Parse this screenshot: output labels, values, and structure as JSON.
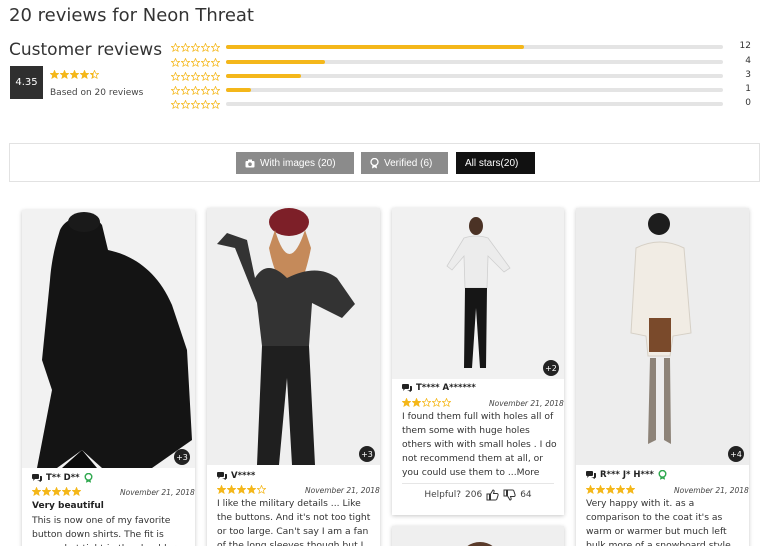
{
  "page": {
    "title": "20 reviews for Neon Threat"
  },
  "summary": {
    "heading": "Customer reviews",
    "average": "4.35",
    "average_stars": 4.35,
    "based_on": "Based on 20 reviews",
    "distribution": [
      {
        "stars": 5,
        "count": "12",
        "fraction": 0.6
      },
      {
        "stars": 4,
        "count": "4",
        "fraction": 0.2
      },
      {
        "stars": 3,
        "count": "3",
        "fraction": 0.15
      },
      {
        "stars": 2,
        "count": "1",
        "fraction": 0.05
      },
      {
        "stars": 1,
        "count": "0",
        "fraction": 0.0
      }
    ]
  },
  "filters": {
    "with_images": "With images (20)",
    "verified": "Verified (6)",
    "all_stars": "All stars(20)"
  },
  "colors": {
    "star": "#f4b71a",
    "bar_track": "#e4e4e4",
    "verified_badge": "#2fa84f"
  },
  "reviews": [
    {
      "author": "T** D**",
      "verified": true,
      "date": "November 21, 2018",
      "stars": 5,
      "extra_images": "+3",
      "title": "Very beautiful",
      "body": "This is now one of my favorite button down shirts. The fit is somewhat tight in the shoulders"
    },
    {
      "author": "V****",
      "verified": false,
      "date": "November 21, 2018",
      "stars": 4,
      "extra_images": "+3",
      "title": "",
      "body": "I like the military details ... Like the buttons. And it's not too tight or too large. Can't say I am a fan of the long sleeves though but I can"
    },
    {
      "author": "T**** A******",
      "verified": false,
      "date": "November 21, 2018",
      "stars": 2,
      "extra_images": "+2",
      "title": "",
      "body": "I found them full with holes all of them some with huge holes others with with small holes . I do not recommend them at all, or you could use them to",
      "more": "...More",
      "helpful_label": "Helpful?",
      "helpful_up": "206",
      "helpful_down": "64"
    },
    {
      "author": "R*** J* H***",
      "verified": true,
      "date": "November 21, 2018",
      "stars": 5,
      "extra_images": "+4",
      "title": "",
      "body": "Very happy with it. as a comparison to the coat it's as warm or warmer but much left bulk more of a snowboard style vs"
    }
  ]
}
